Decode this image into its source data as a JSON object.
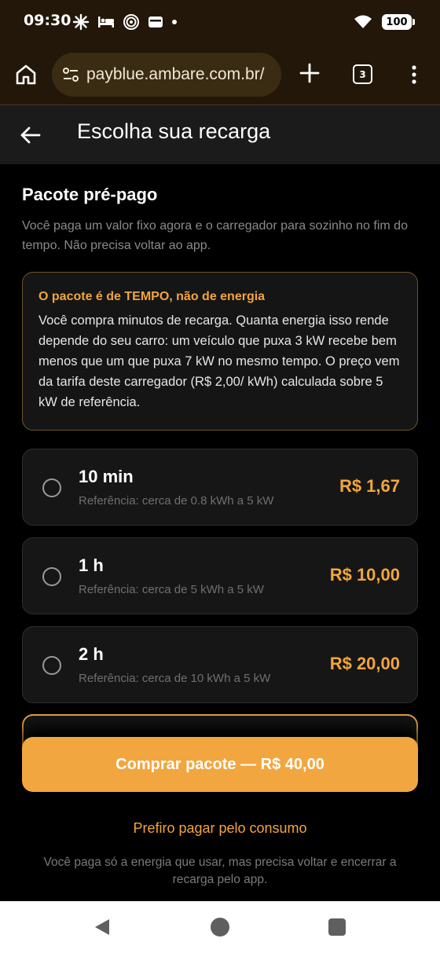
{
  "status_bar": {
    "time": "09:30",
    "battery": "100",
    "icons": [
      "pinwheel-icon",
      "bed-icon",
      "target-icon",
      "wallet-icon",
      "dot-icon",
      "wifi-icon",
      "battery-icon"
    ]
  },
  "browser": {
    "url": "payblue.ambare.com.br/",
    "tab_count": "3"
  },
  "header": {
    "title": "Escolha sua recarga"
  },
  "section": {
    "title": "Pacote pré-pago",
    "description": "Você paga um valor fixo agora e o carregador para sozinho no fim do tempo. Não precisa voltar ao app."
  },
  "info": {
    "title": "O pacote é de TEMPO, não de energia",
    "body": "Você compra minutos de recarga. Quanta energia isso rende depende do seu carro: um veículo que puxa 3 kW recebe bem menos que um que puxa 7 kW no mesmo tempo. O preço vem da tarifa deste carregador (R$ 2,00/ kWh) calculada sobre 5 kW de referência."
  },
  "options": [
    {
      "name": "10 min",
      "reference": "Referência: cerca de 0.8 kWh a 5 kW",
      "price": "R$ 1,67"
    },
    {
      "name": "1 h",
      "reference": "Referência: cerca de 5 kWh a 5 kW",
      "price": "R$ 10,00"
    },
    {
      "name": "2 h",
      "reference": "Referência: cerca de 10 kWh a 5 kW",
      "price": "R$ 20,00"
    }
  ],
  "buy_button": "Comprar pacote — R$ 40,00",
  "alt_link": "Prefiro pagar pelo consumo",
  "alt_description": "Você paga só a energia que usar, mas precisa voltar e encerrar a recarga pelo app.",
  "colors": {
    "accent": "#f2a640",
    "accent_text": "#f2a53d",
    "chrome_bg": "#221709",
    "url_pill": "#3a2c12"
  }
}
